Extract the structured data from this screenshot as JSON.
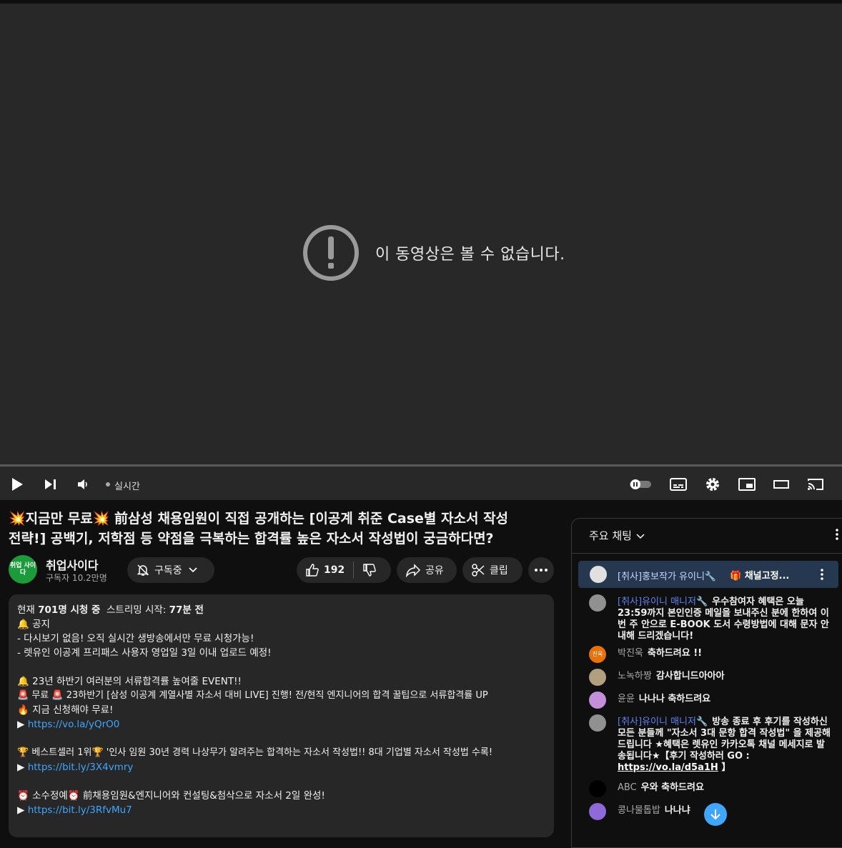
{
  "player": {
    "unavailable_message": "이 동영상은 볼 수 없습니다.",
    "live_label": "실시간",
    "icons": [
      "play-icon",
      "next-icon",
      "volume-icon",
      "autoplay-toggle-icon",
      "subtitles-icon",
      "settings-icon",
      "miniplayer-icon",
      "theater-icon",
      "cast-icon"
    ]
  },
  "video": {
    "title_line1": "💥지금만 무료💥 前삼성 채용임원이 직접 공개하는 [이공계 취준 Case별 자소서 작성",
    "title_line2": "전략!] 공백기, 저학점 등 약점을 극복하는 합격률 높은 자소서 작성법이 궁금하다면?"
  },
  "channel": {
    "name": "취업사이다",
    "avatar_text": "취업 사이다",
    "subscribers": "구독자 10.2만명",
    "subscribe_label": "구독중"
  },
  "actions": {
    "like_count": "192",
    "share_label": "공유",
    "clip_label": "클립"
  },
  "description": {
    "stats_pre": "현재 ",
    "viewers": "701명 시청 중",
    "stats_mid": "  스트리밍 시작: ",
    "started": "77분 전",
    "lines": [
      "🔔 공지",
      "- 다시보기 없음! 오직 실시간 생방송에서만 무료 시청가능!",
      "- 렛유인 이공계 프리패스 사용자 영업일 3일 이내 업로드 예정!",
      "",
      "🔔 23년 하반기 여러분의 서류합격률 높여줄 EVENT!!",
      "🚨 무료 🚨 23하반기 [삼성 이공계 계열사별 자소서 대비 LIVE] 진행! 전/현직 엔지니어의 합격 꿀팁으로 서류합격률 UP",
      "🔥 지금 신청해야 무료!"
    ],
    "link1": "https://vo.la/yQrO0",
    "line_best": "🏆 베스트셀러 1위🏆 '인사 임원 30년 경력 나상무가 알려주는 합격하는 자소서 작성법!! 8대 기업별 자소서 작성법 수록!",
    "link2": "https://bit.ly/3X4vmry",
    "line_edit": "⏰ 소수정예⏰ 前채용임원&엔지니어와 컨설팅&첨삭으로 자소서 2일 완성!",
    "link3": "https://bit.ly/3RfvMu7"
  },
  "chat": {
    "header": "주요 채팅",
    "pinned_author": "[취사]홍보작가 유이니🔧",
    "pinned_text": "🎁 채널고정...",
    "messages": [
      {
        "author": "[취사]유이니 매니저🔧",
        "text": "우수참여자 혜택은 오늘 23:59까지 본인인증 메일을 보내주신 분에 한하여 이번 주 안으로 E-BOOK 도서 수령방법에 대해 문자 안내해 드리겠습니다!",
        "color": "#909090"
      },
      {
        "author": "박진욱",
        "text": "축하드려요 !!",
        "color": "#e8710a",
        "initials": "진욱"
      },
      {
        "author": "노녹하짱",
        "text": "감사합니드아아아",
        "color": "#b0a080"
      },
      {
        "author": "윤윤",
        "text": "나나나 축하드려요",
        "color": "#c28fd8"
      },
      {
        "author": "[취사]유이니 매니저🔧",
        "text": "방송 종료 후 후기를 작성하신 모든 분들께 \"자소서 3대 문항 합격 작성법\" 을 제공해 드립니다 ★혜택은 렛유인 카카오톡 채널 메세지로 발송됩니다★【후기 작성하러 GO : ",
        "link": "https://vo.la/d5a1H",
        "tail": " 】",
        "color": "#909090"
      },
      {
        "author": "ABC",
        "text": "우와 축하드려요",
        "color": "#000000"
      },
      {
        "author": "콩나물톱밥",
        "text": "나나냐",
        "color": "#8e6ad8"
      }
    ]
  },
  "colors": {
    "accent": "#3ea6ff",
    "moderator": "#5e84f1",
    "pinned_bg": "#263850"
  }
}
